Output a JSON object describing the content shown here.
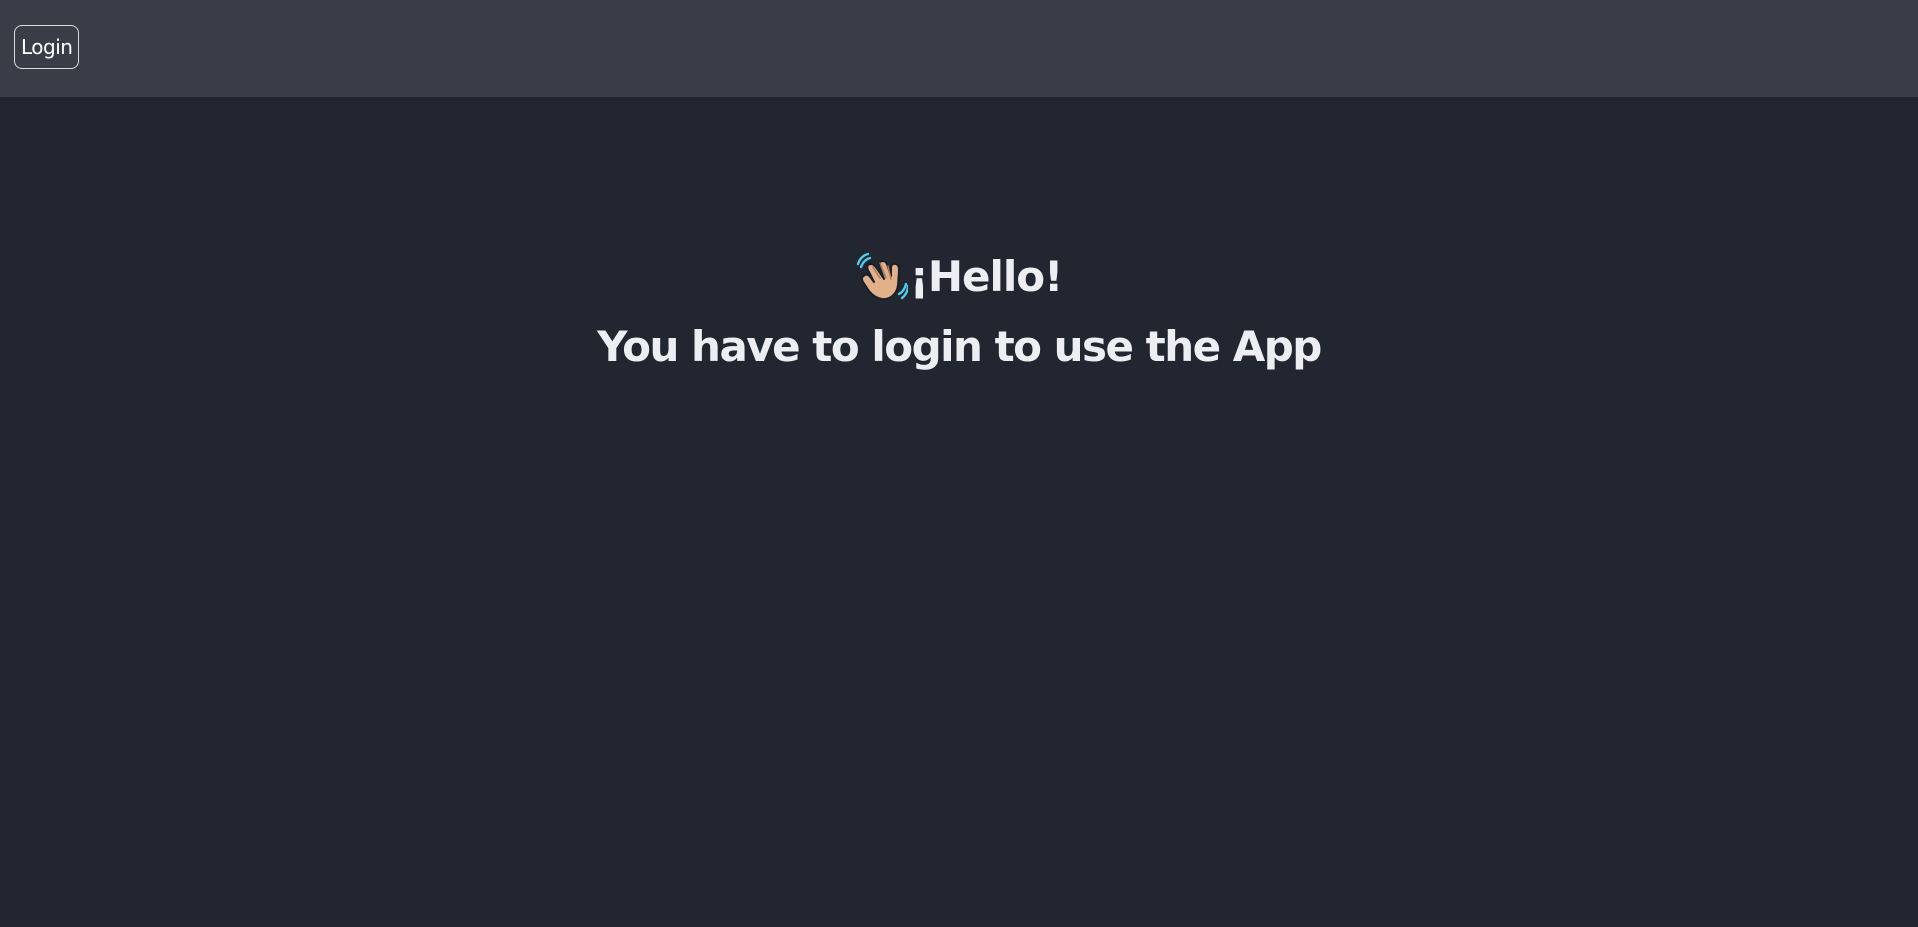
{
  "header": {
    "login_label": "Login"
  },
  "main": {
    "greeting": "¡Hello!",
    "greeting_icon": "waving-hand-icon",
    "message": "You have to login to use the App"
  },
  "colors": {
    "header_background": "#393d47",
    "page_background": "#212631",
    "text": "#eceef1"
  }
}
